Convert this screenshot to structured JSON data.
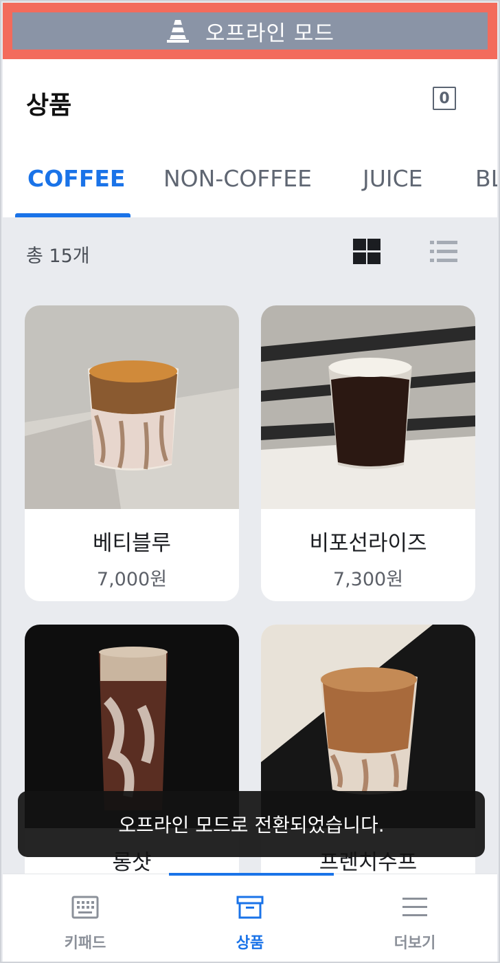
{
  "offline_banner": {
    "label": "오프라인 모드",
    "icon": "traffic-cone-icon",
    "color": "#f36b5c"
  },
  "header": {
    "title": "상품",
    "cart_count": "0"
  },
  "tabs": [
    {
      "label": "COFFEE",
      "active": true
    },
    {
      "label": "NON-COFFEE",
      "active": false
    },
    {
      "label": "JUICE",
      "active": false
    },
    {
      "label": "BL",
      "active": false
    }
  ],
  "filter": {
    "count_label": "총 15개",
    "view_modes": [
      "grid-icon",
      "list-icon"
    ],
    "selected_view": "grid"
  },
  "products": [
    {
      "name": "베티블루",
      "price": "7,000원"
    },
    {
      "name": "비포선라이즈",
      "price": "7,300원"
    },
    {
      "name": "롱샷",
      "price": ""
    },
    {
      "name": "프렌치수프",
      "price": ""
    }
  ],
  "toast": {
    "message": "오프라인 모드로 전환되었습니다."
  },
  "bottom_nav": [
    {
      "label": "키패드",
      "icon": "keypad-icon",
      "active": false
    },
    {
      "label": "상품",
      "icon": "archive-box-icon",
      "active": true
    },
    {
      "label": "더보기",
      "icon": "menu-icon",
      "active": false
    }
  ],
  "colors": {
    "accent": "#1a73e8",
    "offline_red": "#f36b5c",
    "banner_gray": "#8a94a6"
  }
}
